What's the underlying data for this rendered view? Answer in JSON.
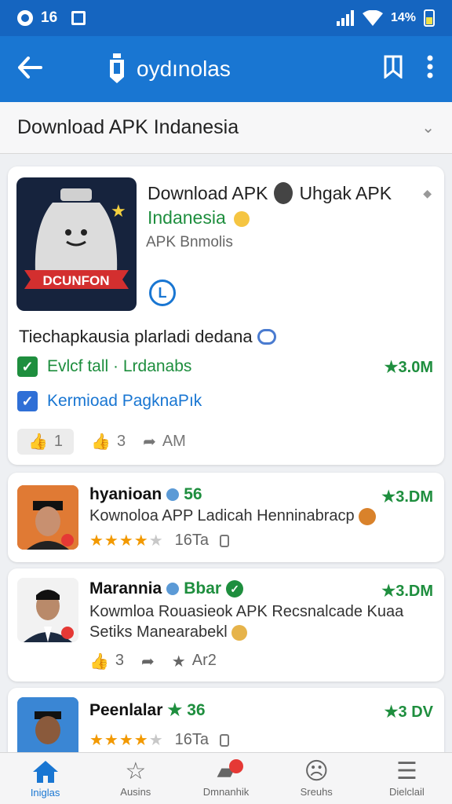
{
  "status": {
    "left_a": "16",
    "right_a": "14%"
  },
  "appbar": {
    "title": "oydınolas"
  },
  "subheader": {
    "title": "Download APK Indanesia"
  },
  "hero": {
    "icon_label": "DCUNFON",
    "title_line1": "Download APK",
    "title_line1b": "Uhgak APK",
    "title_line2": "Indanesia",
    "subtitle": "APK Bnmolis",
    "verify_glyph": "L",
    "description": "Tiechapkausia plarladi dedana",
    "check1": "Evlcf tall · Lrdanabs",
    "check1_rating": "★3.0M",
    "check2": "Kermioad PagknaPık",
    "footer_like": "1",
    "footer_thumb": "3",
    "footer_am": "AM"
  },
  "items": [
    {
      "name": "hyanioan",
      "score": "56",
      "rating": "★3.DM",
      "desc1": "Kownoloa APP Ladicah Henninabracp",
      "desc2": "",
      "stars_text": "16Ta"
    },
    {
      "name": "Marannia",
      "score": "Bbar",
      "rating": "★3.DM",
      "desc1": "Kowmloa Rouasieok APK Recsnalcade Kuaa",
      "desc2": "Setiks Manearabekl",
      "footer_a": "3",
      "footer_b": "Ar2"
    },
    {
      "name": "Peenlalar",
      "score": "36",
      "rating": "★3 DV",
      "desc1": "",
      "desc2": "",
      "stars_text": "16Ta"
    }
  ],
  "nav": [
    {
      "label": "Iniglas",
      "active": true
    },
    {
      "label": "Ausins"
    },
    {
      "label": "Dmnanhik"
    },
    {
      "label": "Sreuhs"
    },
    {
      "label": "Dielclail"
    }
  ],
  "colors": {
    "primary": "#1976d2",
    "statusbar": "#1565c0",
    "green": "#1e8e3e",
    "star": "#f29900"
  }
}
